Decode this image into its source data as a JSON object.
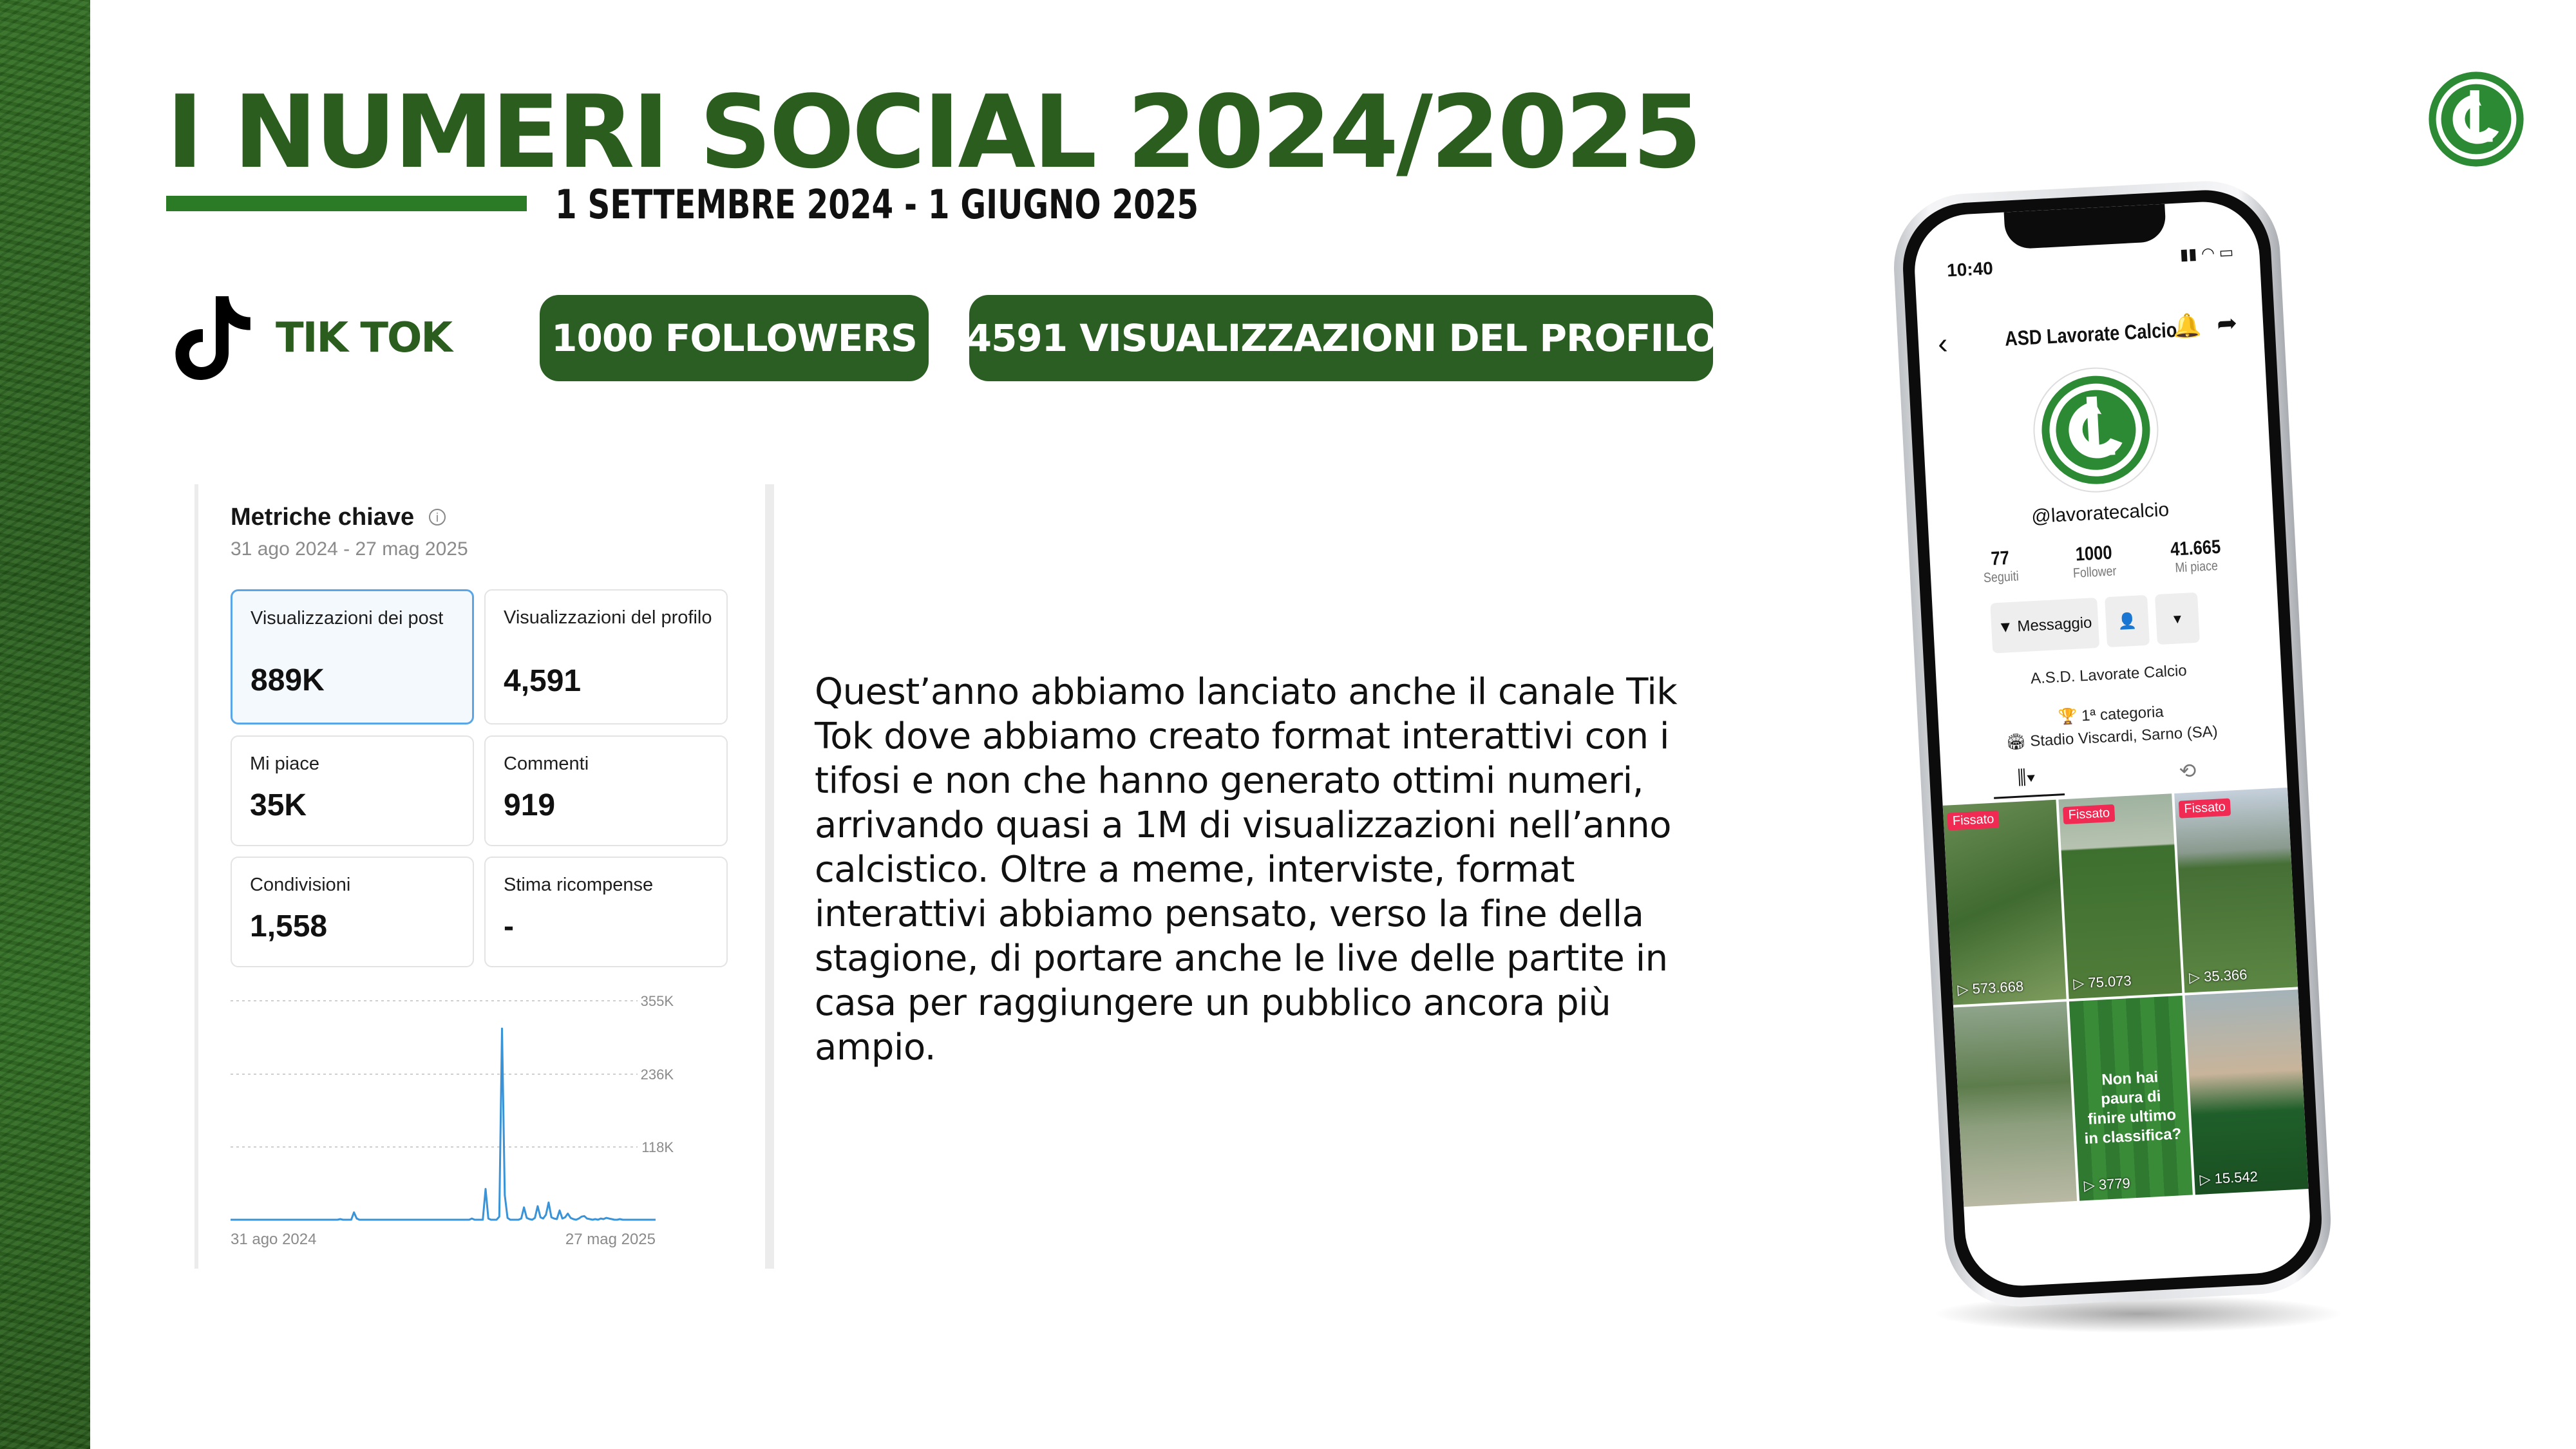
{
  "header": {
    "title": "I NUMERI SOCIAL 2024/2025",
    "subtitle": "1 SETTEMBRE 2024 - 1 GIUGNO 2025"
  },
  "platform": {
    "label": "TIK TOK",
    "icon": "tiktok-icon"
  },
  "badges": {
    "followers": "1000 FOLLOWERS",
    "profile_views": "4591  VISUALIZZAZIONI DEL PROFILO"
  },
  "metrics_panel": {
    "title": "Metriche chiave",
    "date_range": "31 ago 2024 - 27 mag 2025",
    "cards": [
      {
        "label": "Visualizzazioni dei post",
        "value": "889K"
      },
      {
        "label": "Visualizzazioni del profilo",
        "value": "4,591"
      },
      {
        "label": "Mi piace",
        "value": "35K"
      },
      {
        "label": "Commenti",
        "value": "919"
      },
      {
        "label": "Condivisioni",
        "value": "1,558"
      },
      {
        "label": "Stima ricompense",
        "value": "-"
      }
    ]
  },
  "chart_data": {
    "type": "line",
    "title": "",
    "xlabel": "",
    "ylabel": "",
    "x_tick_labels": [
      "31 ago 2024",
      "27 mag 2025"
    ],
    "y_tick_labels": [
      "118K",
      "236K",
      "355K"
    ],
    "ylim": [
      0,
      355000
    ],
    "grid": true,
    "series": [
      {
        "values": [
          0,
          0,
          0,
          0,
          0,
          0,
          0,
          0,
          0,
          0,
          0,
          0,
          0,
          0,
          0,
          0,
          0,
          0,
          0,
          0,
          0,
          0,
          0,
          0,
          0,
          0,
          0,
          0,
          0,
          0,
          0,
          0,
          0,
          0,
          0,
          0,
          0,
          0,
          0,
          0,
          1000,
          0,
          0,
          0,
          0,
          12000,
          2000,
          0,
          0,
          0,
          0,
          0,
          0,
          0,
          0,
          0,
          0,
          0,
          0,
          0,
          0,
          0,
          0,
          0,
          0,
          0,
          0,
          0,
          0,
          0,
          0,
          0,
          0,
          0,
          0,
          0,
          0,
          0,
          0,
          0,
          0,
          0,
          0,
          0,
          0,
          0,
          0,
          0,
          2000,
          0,
          0,
          0,
          0,
          50000,
          2000,
          0,
          0,
          0,
          5000,
          310000,
          40000,
          3000,
          0,
          0,
          0,
          0,
          2000,
          20000,
          3000,
          1000,
          0,
          3000,
          22000,
          4000,
          2000,
          8000,
          28000,
          4000,
          2000,
          1000,
          15000,
          2000,
          4000,
          10000,
          3000,
          1000,
          0,
          2000,
          5000,
          6000,
          2000,
          1000,
          0,
          1000,
          0,
          2000,
          1000,
          3000,
          2000,
          1000,
          0,
          0,
          1000,
          0,
          0,
          0,
          0,
          0,
          0,
          0,
          0,
          0,
          0,
          0,
          0,
          0
        ]
      }
    ]
  },
  "body_text": "Quest’anno abbiamo lanciato anche il canale Tik Tok dove abbiamo creato format interattivi con i tifosi e non che hanno generato ottimi numeri, arrivando quasi a 1M di visualizzazioni nell’anno calcistico. Oltre a meme, interviste, format interattivi abbiamo pensato, verso la fine della stagione, di portare anche le live delle partite in casa per raggiungere un pubblico ancora più ampio.",
  "phone": {
    "time": "10:40",
    "profile_name": "ASD Lavorate Calcio",
    "handle": "@lavoratecalcio",
    "stats": [
      {
        "value": "77",
        "label": "Seguiti"
      },
      {
        "value": "1000",
        "label": "Follower"
      },
      {
        "value": "41.665",
        "label": "Mi piace"
      }
    ],
    "message_button": "Messaggio",
    "bio_name": "A.S.D. Lavorate Calcio",
    "bio_category": "1ª categoria",
    "bio_location": "Stadio Viscardi, Sarno (SA)",
    "pinned_label": "Fissato",
    "tiles": [
      {
        "views": "573.668"
      },
      {
        "views": "75.073"
      },
      {
        "views": "35.366"
      },
      {
        "views": ""
      },
      {
        "views": "3779",
        "caption": "Non hai paura di finire ultimo in classifica?"
      },
      {
        "views": "15.542"
      }
    ]
  },
  "colors": {
    "brand_green": "#2b5e1e",
    "pill_green": "#2b5e22",
    "chart_line": "#3a93d6",
    "pinned_red": "#f02a52"
  }
}
